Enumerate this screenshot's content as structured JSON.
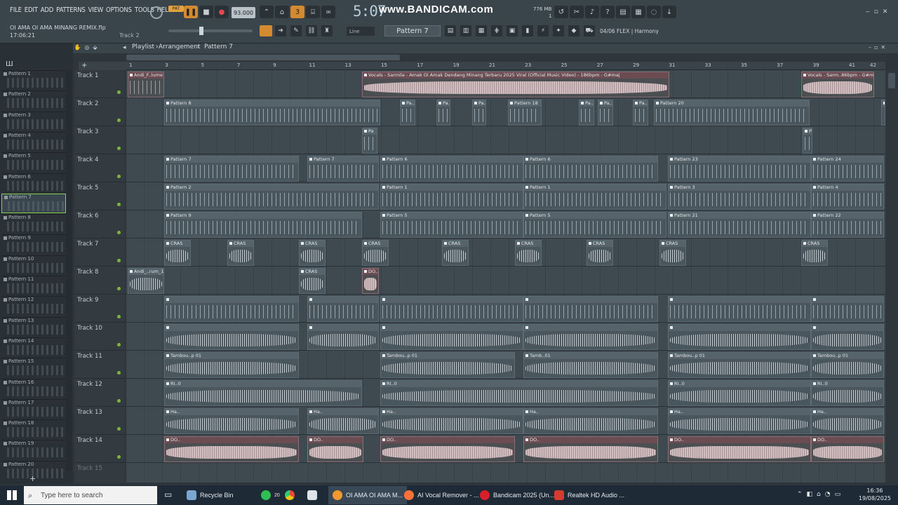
{
  "menu": [
    "FILE",
    "EDIT",
    "ADD",
    "PATTERNS",
    "VIEW",
    "OPTIONS",
    "TOOLS",
    "HELP"
  ],
  "project": {
    "file": "OI AMA OI AMA MINANG REMIX.flp",
    "time": "17:06:21",
    "hint_track": "Track 2"
  },
  "transport": {
    "pat_label": "PAT",
    "song_label": "SONG",
    "tempo": "93.000",
    "clock": "5:07",
    "clock_sub": "",
    "mem": "776 MB",
    "cpu": "1"
  },
  "watermark": "www.BANDICAM.com",
  "hint_bar": "04/06  FLEX | Harmony",
  "snap": {
    "mode": "Line",
    "pattern": "Pattern 7"
  },
  "breadcrumb": [
    "Playlist",
    "Arrangement",
    "Pattern 7"
  ],
  "patterns": [
    "Pattern 1",
    "Pattern 2",
    "Pattern 3",
    "Pattern 4",
    "Pattern 5",
    "Pattern 6",
    "Pattern 7",
    "Pattern 8",
    "Pattern 9",
    "Pattern 10",
    "Pattern 11",
    "Pattern 12",
    "Pattern 13",
    "Pattern 14",
    "Pattern 15",
    "Pattern 16",
    "Pattern 17",
    "Pattern 18",
    "Pattern 19",
    "Pattern 20"
  ],
  "selected_pattern": "Pattern 7",
  "tracks": [
    "Track 1",
    "Track 2",
    "Track 3",
    "Track 4",
    "Track 5",
    "Track 6",
    "Track 7",
    "Track 8",
    "Track 9",
    "Track 10",
    "Track 11",
    "Track 12",
    "Track 13",
    "Track 14",
    "Track 15"
  ],
  "ruler": [
    "1",
    "3",
    "5",
    "7",
    "9",
    "11",
    "13",
    "15",
    "17",
    "19",
    "21",
    "23",
    "25",
    "27",
    "29",
    "31",
    "33",
    "35",
    "37",
    "39",
    "41",
    "42"
  ],
  "clips": {
    "t1": [
      "Andi_F..lume",
      "Vocals - Sarmila - Amak Oi Amak Dendang Minang Terbaru 2025 Viral (Official Music Video) - 186bpm - G#maj",
      "Vocals - Sarm..86bpm - G#maj"
    ],
    "t2": [
      "Pattern 8",
      "Pa..4",
      "Pa..6",
      "Pa..7",
      "Pattern 18",
      "Pa..8",
      "Pa..9",
      "Pa..1",
      "Pattern 20",
      "Pat..5"
    ],
    "t3": [
      "Pa",
      "Pa"
    ],
    "t4": [
      "Pattern 7",
      "Pattern 7",
      "Pattern 6",
      "Pattern 6",
      "Pattern 23",
      "Pattern 24"
    ],
    "t5": [
      "Pattern 2",
      "Pattern 1",
      "Pattern 1",
      "Pattern 3",
      "Pattern 4"
    ],
    "t6": [
      "Pattern 9",
      "Pattern 5",
      "Pattern 5",
      "Pattern 21",
      "Pattern 22"
    ],
    "t7": [
      "CRAS",
      "CRAS",
      "CRAS",
      "CRAS",
      "CRAS",
      "CRAS",
      "CRAS",
      "CRAS",
      "CRAS"
    ],
    "t8": [
      "Andi_..rum_1",
      "CRAS",
      "DO.."
    ],
    "t11": [
      "Tambou..p 01",
      "Tambou..p 01",
      "Tamb..01"
    ],
    "t12": [
      "RI..0",
      "RI..0",
      "RI..0"
    ],
    "t13": [
      "Ha..",
      "Ha..",
      "Ha.."
    ],
    "t14": [
      "DO..",
      "DO..",
      "DO.."
    ]
  },
  "taskbar": {
    "search_placeholder": "Type here to search",
    "items": [
      "Recycle Bin",
      "OI AMA OI AMA M...",
      "AI Vocal Remover - ...",
      "Bandicam 2025 (Un...",
      "Realtek HD Audio ..."
    ],
    "whatsapp_badge": "20",
    "time": "16:36",
    "date": "19/08/2025"
  }
}
